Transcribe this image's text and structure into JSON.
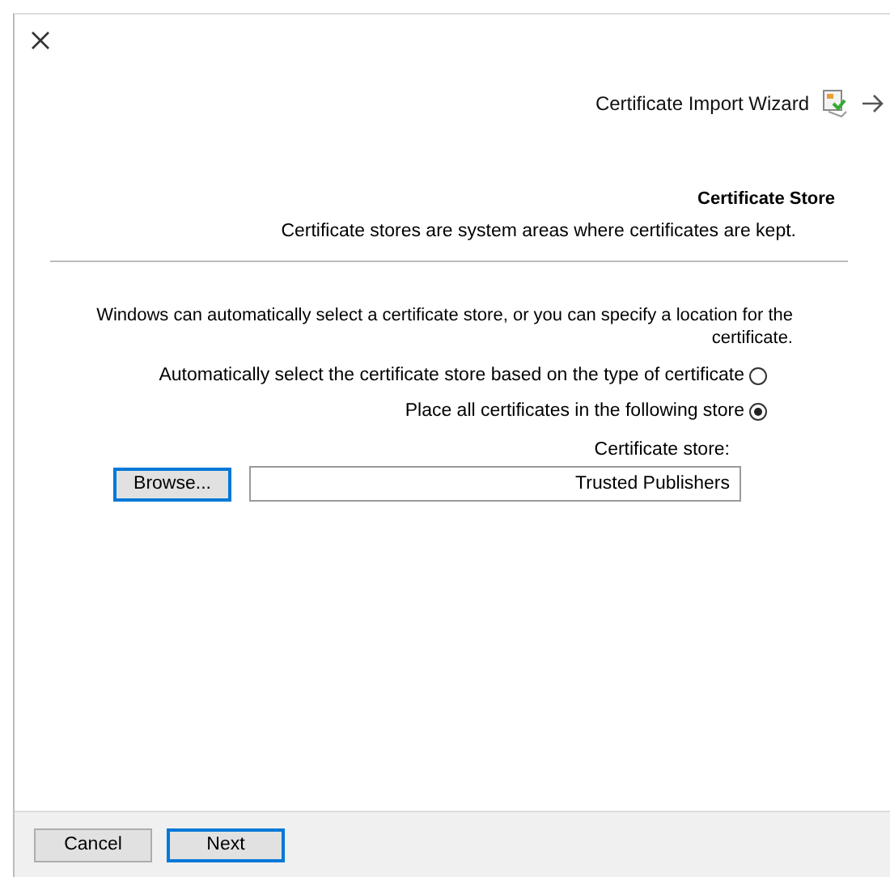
{
  "window": {
    "title": "Certificate Import Wizard"
  },
  "section": {
    "heading": "Certificate Store",
    "description": "Certificate stores are system areas where certificates are kept."
  },
  "intro": "Windows can automatically select a certificate store, or you can specify a location for the certificate.",
  "options": [
    {
      "label": "Automatically select the certificate store based on the type of certificate",
      "selected": false
    },
    {
      "label": "Place all certificates in the following store",
      "selected": true
    }
  ],
  "store": {
    "label": "Certificate store:",
    "value": "Trusted Publishers",
    "browse": "Browse..."
  },
  "buttons": [
    {
      "label": "Cancel",
      "default": false
    },
    {
      "label": "Next",
      "default": true
    }
  ]
}
